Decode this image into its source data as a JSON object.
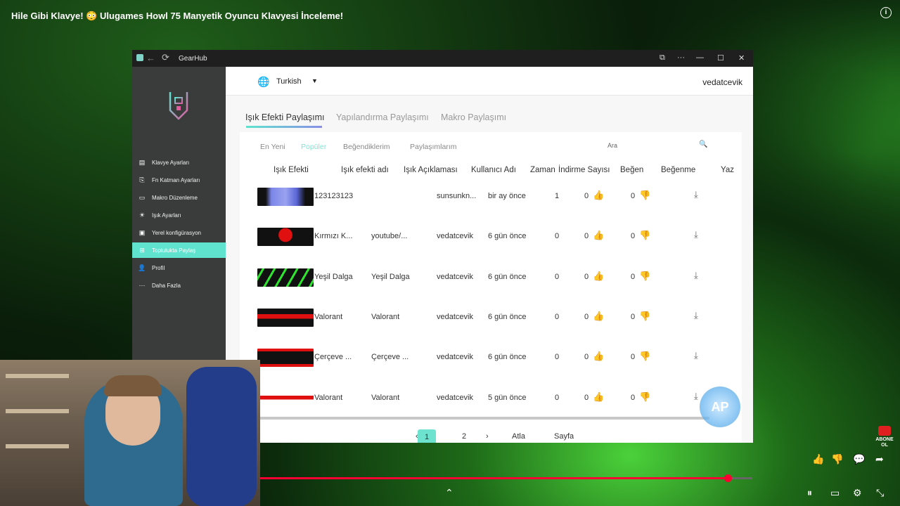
{
  "video": {
    "title": "Hile Gibi Klavye! 😳 Ulugames Howl 75 Manyetik Oyuncu Klavyesi İnceleme!",
    "progress": 0.95,
    "subscribe_badge": "ABONE OL"
  },
  "app": {
    "window_title": "GearHub",
    "language": "Turkish",
    "username": "vedatcevik",
    "sidebar": {
      "items": [
        {
          "label": "Klavye Ayarları",
          "icon": "keyboard-icon",
          "glyph": "▤"
        },
        {
          "label": "Fn Katman Ayarları",
          "icon": "fn-icon",
          "glyph": "⎘"
        },
        {
          "label": "Makro Düzenleme",
          "icon": "macro-icon",
          "glyph": "▭"
        },
        {
          "label": "Işık Ayarları",
          "icon": "light-icon",
          "glyph": "☀"
        },
        {
          "label": "Yerel konfigürasyon",
          "icon": "local-config-icon",
          "glyph": "▣"
        },
        {
          "label": "Toplulukta Paylaş",
          "icon": "share-icon",
          "glyph": "⊞"
        },
        {
          "label": "Profil",
          "icon": "profile-icon",
          "glyph": "👤"
        },
        {
          "label": "Daha Fazla",
          "icon": "more-icon",
          "glyph": "···"
        }
      ],
      "active_index": 5
    },
    "tabs": [
      "Işık Efekti Paylaşımı",
      "Yapılandırma Paylaşımı",
      "Makro Paylaşımı"
    ],
    "subtabs": [
      "En Yeni",
      "Popüler",
      "Beğendiklerim",
      "Paylaşımlarım"
    ],
    "search_placeholder": "Ara",
    "table": {
      "headers": [
        "Işık Efekti",
        "Işık efekti adı",
        "Işık Açıklaması",
        "Kullanıcı Adı",
        "Zaman",
        "İndirme Sayısı",
        "Beğen",
        "Beğenme",
        "Yaz"
      ],
      "rows": [
        {
          "name": "123123123",
          "desc": "",
          "user": "sunsunkn...",
          "time": "bir ay önce",
          "downloads": "1",
          "likes": "0",
          "dislikes": "0"
        },
        {
          "name": "Kırmızı K...",
          "desc": "youtube/...",
          "user": "vedatcevik",
          "time": "6 gün önce",
          "downloads": "0",
          "likes": "0",
          "dislikes": "0"
        },
        {
          "name": "Yeşil Dalga",
          "desc": "Yeşil Dalga",
          "user": "vedatcevik",
          "time": "6 gün önce",
          "downloads": "0",
          "likes": "0",
          "dislikes": "0"
        },
        {
          "name": "Valorant",
          "desc": "Valorant",
          "user": "vedatcevik",
          "time": "6 gün önce",
          "downloads": "0",
          "likes": "0",
          "dislikes": "0"
        },
        {
          "name": "Çerçeve ...",
          "desc": "Çerçeve ...",
          "user": "vedatcevik",
          "time": "6 gün önce",
          "downloads": "0",
          "likes": "0",
          "dislikes": "0"
        },
        {
          "name": "Valorant",
          "desc": "Valorant",
          "user": "vedatcevik",
          "time": "5 gün önce",
          "downloads": "0",
          "likes": "0",
          "dislikes": "0"
        }
      ]
    },
    "pagination": {
      "prev": "‹",
      "pages": [
        "1",
        "2"
      ],
      "next": "›",
      "jump": "Atla",
      "page": "Sayfa"
    }
  },
  "colors": {
    "accent": "#5fe3cf",
    "sidebar_bg": "#3a3c3b",
    "progress": "#ff0033"
  }
}
